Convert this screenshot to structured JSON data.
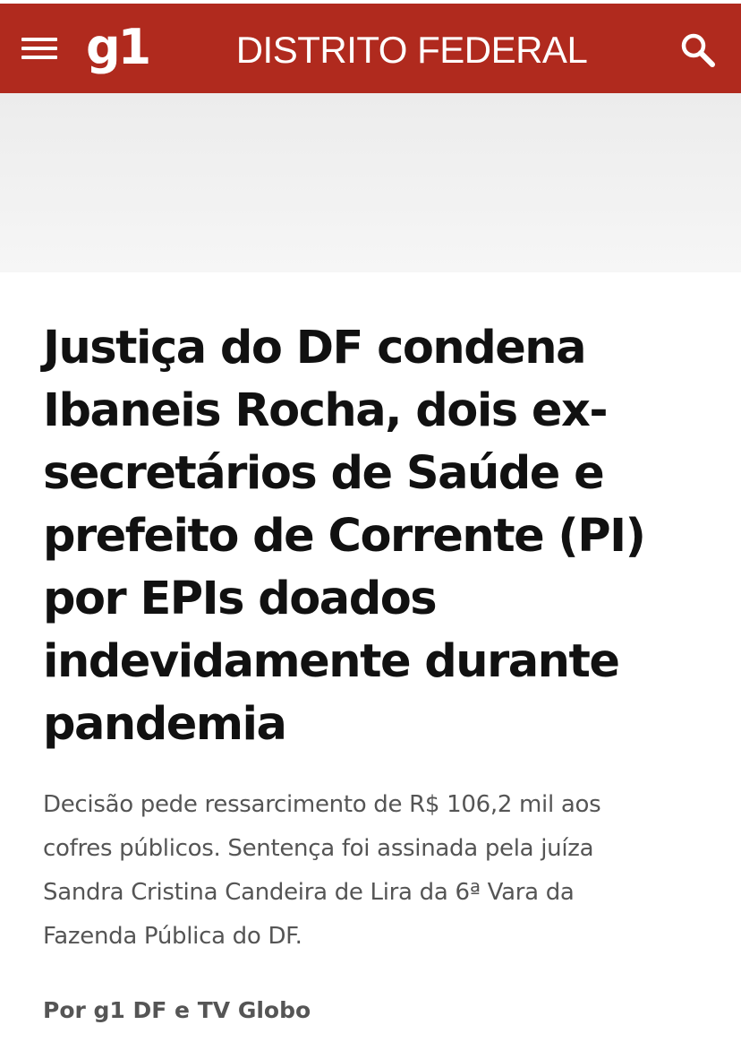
{
  "header": {
    "logo": "g1",
    "section": "DISTRITO FEDERAL",
    "menu_icon": "hamburger-menu-icon",
    "search_icon": "search-icon",
    "background_color": "#b02a1e"
  },
  "article": {
    "headline_lines": [
      "Justiça do DF condena",
      "Ibaneis Rocha, dois ex-",
      "secretários de Saúde e",
      "prefeito de Corrente (PI)",
      "por EPIs doados",
      "indevidamente durante",
      "pandemia"
    ],
    "subtitle_lines": [
      "Decisão pede ressarcimento de R$ 106,2 mil aos",
      "cofres públicos. Sentença foi assinada pela juíza",
      "Sandra Cristina Candeira de Lira da 6ª Vara da",
      "Fazenda Pública do DF."
    ],
    "byline": "Por g1 DF e TV Globo"
  }
}
